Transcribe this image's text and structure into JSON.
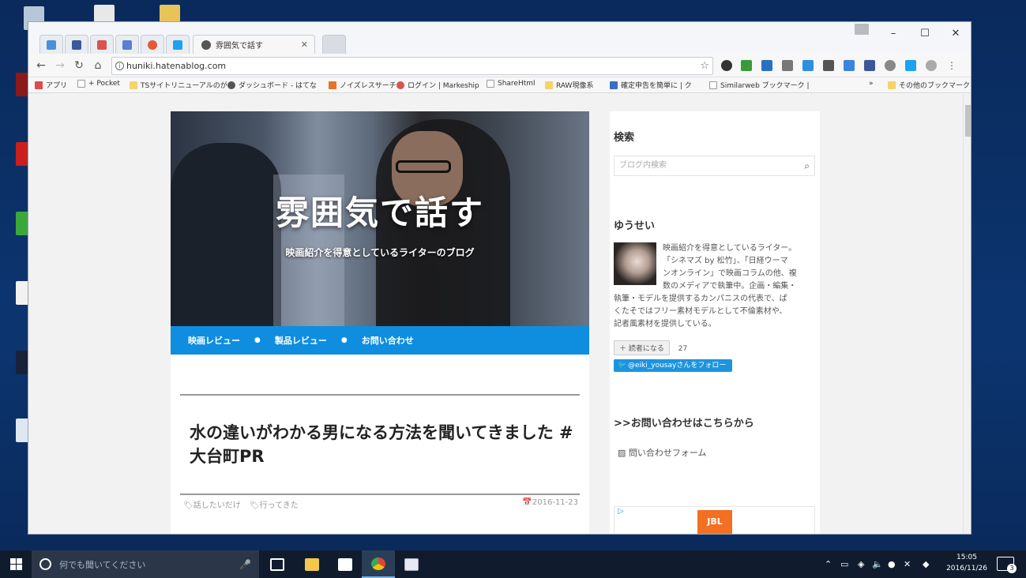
{
  "browser": {
    "active_tab_title": "雰囲気で話す",
    "url": "huniki.hatenablog.com",
    "bookmarks": [
      "アプリ",
      "+ Pocket",
      "TSサイトリニューアルのが",
      "ダッシュボード - はてな",
      "ノイズレスサーチ",
      "ログイン | Markeship",
      "ShareHtml",
      "RAW現像系",
      "確定申告を簡単に | ク",
      "Similarweb ブックマーク |"
    ],
    "bookmarks_overflow": "»",
    "other_bookmarks": "その他のブックマーク"
  },
  "blog": {
    "title": "雰囲気で話す",
    "description": "映画紹介を得意としているライターのブログ",
    "nav": [
      "映画レビュー",
      "製品レビュー",
      "お問い合わせ"
    ],
    "nav_separator": "●",
    "entry_title": "水の違いがわかる男になる方法を聞いてきました #大台町PR",
    "categories": [
      "話したいだけ",
      "行ってきた"
    ],
    "date": "2016-11-23"
  },
  "sidebar": {
    "search_heading": "検索",
    "search_placeholder": "ブログ内検索",
    "profile_heading": "ゆうせい",
    "profile_text_indented": [
      "映画紹介を得意としているライター。",
      "「シネマズ by 松竹」、「日経ウーマ",
      "ンオンライン」で映画コラムの他、複",
      "数のメディアで執筆中。企画・編集・"
    ],
    "profile_text_full": [
      "執筆・モデルを提供するカンパニスの代表で、ぱ",
      "くたそではフリー素材モデルとして不倫素材や、",
      "記者風素材を提供している。"
    ],
    "reader_button": "読者になる",
    "reader_count": "27",
    "twitter_follow": "@eiki_yousayさんをフォロー",
    "contact_heading": ">>お問い合わせはこちらから",
    "contact_link": "問い合わせフォーム",
    "ad_brand": "JBL"
  },
  "taskbar": {
    "search_placeholder": "何でも聞いてください",
    "time": "15:05",
    "date": "2016/11/26",
    "notification_count": "3"
  },
  "colors": {
    "nav_blue": "#0f8ee0",
    "twitter_blue": "#1b95e0",
    "taskbar": "#101c2e",
    "desktop": "#0c3570"
  }
}
